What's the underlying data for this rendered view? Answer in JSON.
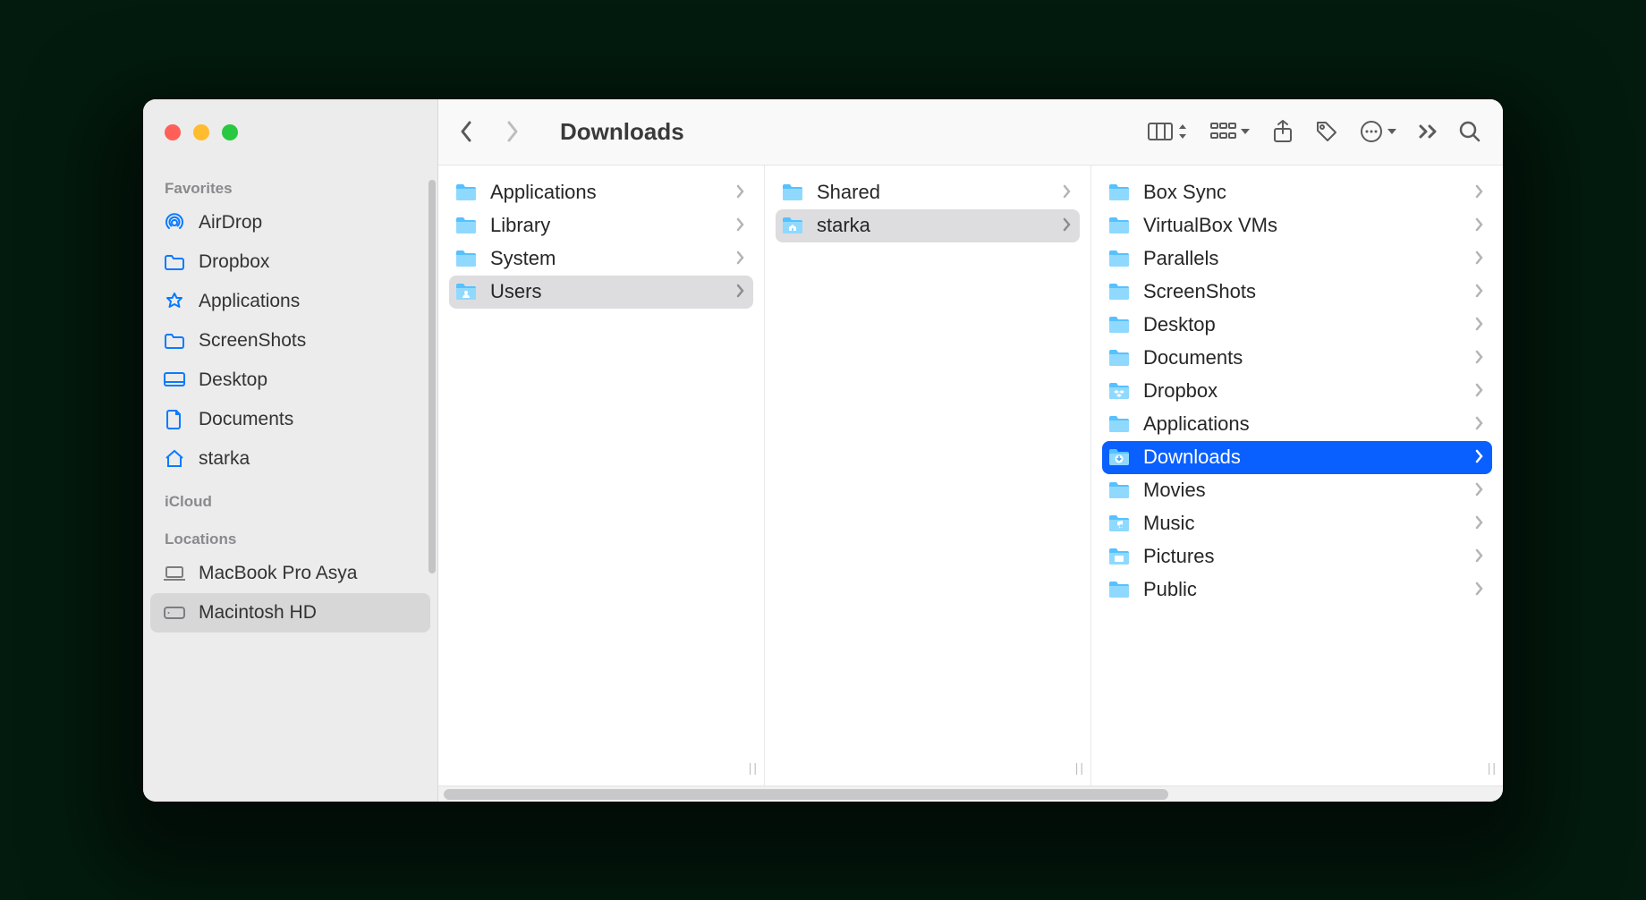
{
  "window": {
    "title": "Downloads"
  },
  "sidebar": {
    "headings": {
      "favorites": "Favorites",
      "icloud": "iCloud",
      "locations": "Locations"
    },
    "favorites": [
      {
        "icon": "airdrop",
        "label": "AirDrop"
      },
      {
        "icon": "folder",
        "label": "Dropbox"
      },
      {
        "icon": "app",
        "label": "Applications"
      },
      {
        "icon": "folder",
        "label": "ScreenShots"
      },
      {
        "icon": "desktop",
        "label": "Desktop"
      },
      {
        "icon": "doc",
        "label": "Documents"
      },
      {
        "icon": "home",
        "label": "starka"
      }
    ],
    "locations": [
      {
        "icon": "laptop",
        "label": "MacBook Pro Asya",
        "selected": false
      },
      {
        "icon": "disk",
        "label": "Macintosh HD",
        "selected": true
      }
    ]
  },
  "columns": [
    {
      "items": [
        {
          "label": "Applications",
          "type": "folder"
        },
        {
          "label": "Library",
          "type": "folder"
        },
        {
          "label": "System",
          "type": "folder"
        },
        {
          "label": "Users",
          "type": "folder-users",
          "selected": "path"
        }
      ]
    },
    {
      "items": [
        {
          "label": "Shared",
          "type": "folder"
        },
        {
          "label": "starka",
          "type": "folder-home",
          "selected": "path"
        }
      ]
    },
    {
      "items": [
        {
          "label": "Box Sync",
          "type": "folder"
        },
        {
          "label": "VirtualBox VMs",
          "type": "folder"
        },
        {
          "label": "Parallels",
          "type": "folder"
        },
        {
          "label": "ScreenShots",
          "type": "folder"
        },
        {
          "label": "Desktop",
          "type": "folder"
        },
        {
          "label": "Documents",
          "type": "folder"
        },
        {
          "label": "Dropbox",
          "type": "folder-dropbox"
        },
        {
          "label": "Applications",
          "type": "folder"
        },
        {
          "label": "Downloads",
          "type": "folder-downloads",
          "selected": "active"
        },
        {
          "label": "Movies",
          "type": "folder"
        },
        {
          "label": "Music",
          "type": "folder"
        },
        {
          "label": "Pictures",
          "type": "folder"
        },
        {
          "label": "Public",
          "type": "folder"
        }
      ]
    }
  ]
}
